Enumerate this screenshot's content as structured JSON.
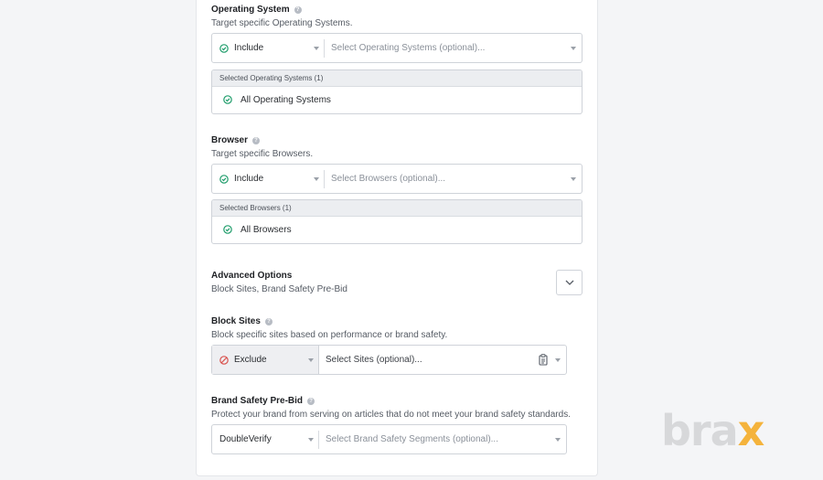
{
  "os": {
    "title": "Operating System",
    "description": "Target specific Operating Systems.",
    "mode": "Include",
    "placeholder": "Select Operating Systems (optional)...",
    "selected_header": "Selected Operating Systems (1)",
    "selected_item": "All Operating Systems"
  },
  "browser": {
    "title": "Browser",
    "description": "Target specific Browsers.",
    "mode": "Include",
    "placeholder": "Select Browsers (optional)...",
    "selected_header": "Selected Browsers (1)",
    "selected_item": "All Browsers"
  },
  "advanced": {
    "title": "Advanced Options",
    "description": "Block Sites, Brand Safety Pre-Bid"
  },
  "block_sites": {
    "title": "Block Sites",
    "description": "Block specific sites based on performance or brand safety.",
    "mode": "Exclude",
    "placeholder": "Select Sites (optional)..."
  },
  "brand_safety": {
    "title": "Brand Safety Pre-Bid",
    "description": "Protect your brand from serving on articles that do not meet your brand safety standards.",
    "provider": "DoubleVerify",
    "placeholder": "Select Brand Safety Segments (optional)..."
  },
  "watermark": {
    "text_main": "bra",
    "text_accent": "x"
  },
  "colors": {
    "include_green": "#1f9d6b",
    "exclude_red": "#d9534f",
    "accent": "#f4b33c"
  }
}
